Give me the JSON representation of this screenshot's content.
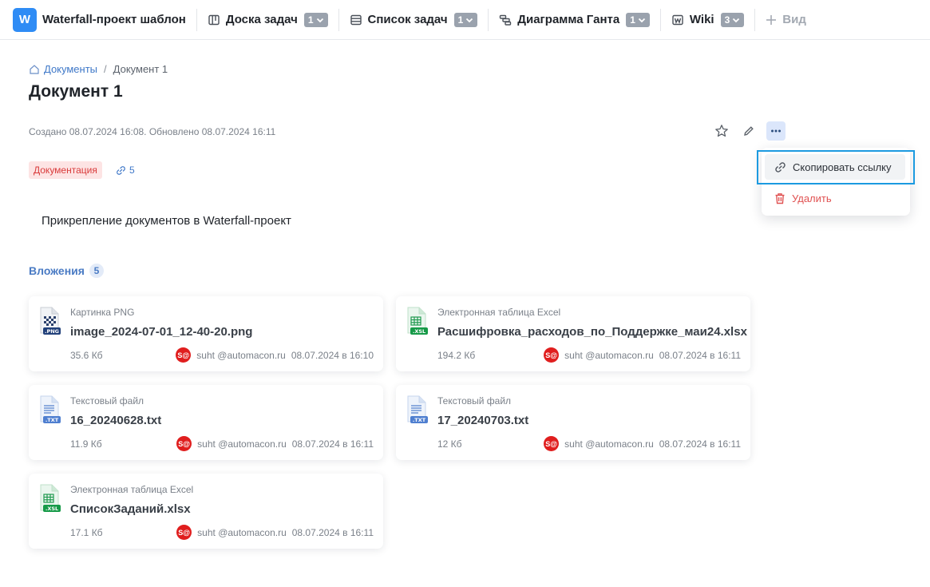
{
  "project": {
    "logo_letter": "W",
    "name": "Waterfall-проект шаблон"
  },
  "views": [
    {
      "label": "Доска задач",
      "count": "1"
    },
    {
      "label": "Список задач",
      "count": "1"
    },
    {
      "label": "Диаграмма Ганта",
      "count": "1"
    },
    {
      "label": "Wiki",
      "count": "3"
    }
  ],
  "add_view_label": "Вид",
  "breadcrumb": {
    "root": "Документы",
    "current": "Документ 1"
  },
  "document": {
    "title": "Документ 1",
    "meta": "Создано 08.07.2024 16:08. Обновлено 08.07.2024 16:11",
    "tag": "Документация",
    "links_count": "5",
    "description": "Прикрепление документов в Waterfall-проект"
  },
  "menu": {
    "copy_link": "Скопировать ссылку",
    "delete": "Удалить"
  },
  "attachments": {
    "title": "Вложения",
    "count": "5",
    "items": [
      {
        "type": "Картинка PNG",
        "name": "image_2024-07-01_12-40-20.png",
        "size": "35.6 Кб",
        "avatar": "S@",
        "user": "suht @automacon.ru",
        "date": "08.07.2024 в 16:10",
        "ext": ".PNG",
        "icon": "image-file-icon"
      },
      {
        "type": "Электронная таблица Excel",
        "name": "Расшифровка_расходов_по_Поддержке_маи24.xlsx",
        "size": "194.2 Кб",
        "avatar": "S@",
        "user": "suht @automacon.ru",
        "date": "08.07.2024 в 16:11",
        "ext": ".XSL",
        "icon": "excel-file-icon"
      },
      {
        "type": "Текстовый файл",
        "name": "16_20240628.txt",
        "size": "11.9 Кб",
        "avatar": "S@",
        "user": "suht @automacon.ru",
        "date": "08.07.2024 в 16:11",
        "ext": ".TXT",
        "icon": "text-file-icon"
      },
      {
        "type": "Текстовый файл",
        "name": "17_20240703.txt",
        "size": "12 Кб",
        "avatar": "S@",
        "user": "suht @automacon.ru",
        "date": "08.07.2024 в 16:11",
        "ext": ".TXT",
        "icon": "text-file-icon"
      },
      {
        "type": "Электронная таблица Excel",
        "name": "СписокЗаданий.xlsx",
        "size": "17.1 Кб",
        "avatar": "S@",
        "user": "suht @automacon.ru",
        "date": "08.07.2024 в 16:11",
        "ext": ".XSL",
        "icon": "excel-file-icon"
      }
    ]
  },
  "colors": {
    "accent": "#2f8cf5",
    "link": "#3f78c8",
    "tag_bg": "#fde4e4",
    "tag_text": "#d93b3b",
    "danger": "#e05252",
    "highlight": "#1c9ae0",
    "avatar": "#e01e1e"
  }
}
